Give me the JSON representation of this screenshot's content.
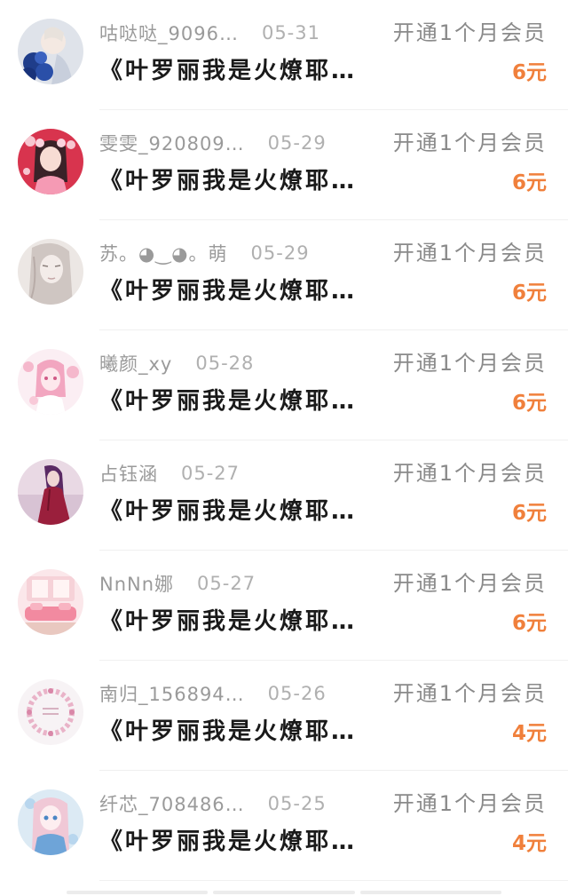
{
  "records": [
    {
      "nickname": "咕哒哒_9096…",
      "date": "05-31",
      "action": "开通1个月会员",
      "book": "《叶罗丽我是火燎耶…",
      "price": "6元",
      "avatar_icon": "avatar-blue-flowers"
    },
    {
      "nickname": "雯雯_920809…",
      "date": "05-29",
      "action": "开通1个月会员",
      "book": "《叶罗丽我是火燎耶…",
      "price": "6元",
      "avatar_icon": "avatar-pink-girl"
    },
    {
      "nickname": "苏。◕‿◕。萌",
      "date": "05-29",
      "action": "开通1个月会员",
      "book": "《叶罗丽我是火燎耶…",
      "price": "6元",
      "avatar_icon": "avatar-sketch-girl"
    },
    {
      "nickname": "曦颜_xy",
      "date": "05-28",
      "action": "开通1个月会员",
      "book": "《叶罗丽我是火燎耶…",
      "price": "6元",
      "avatar_icon": "avatar-pink-anime"
    },
    {
      "nickname": "占钰涵",
      "date": "05-27",
      "action": "开通1个月会员",
      "book": "《叶罗丽我是火燎耶…",
      "price": "6元",
      "avatar_icon": "avatar-purple-dress"
    },
    {
      "nickname": "NnNn娜",
      "date": "05-27",
      "action": "开通1个月会员",
      "book": "《叶罗丽我是火燎耶…",
      "price": "6元",
      "avatar_icon": "avatar-pink-room"
    },
    {
      "nickname": "南归_156894…",
      "date": "05-26",
      "action": "开通1个月会员",
      "book": "《叶罗丽我是火燎耶…",
      "price": "4元",
      "avatar_icon": "avatar-floral-wreath"
    },
    {
      "nickname": "纤芯_708486…",
      "date": "05-25",
      "action": "开通1个月会员",
      "book": "《叶罗丽我是火燎耶…",
      "price": "4元",
      "avatar_icon": "avatar-blue-anime"
    }
  ],
  "colors": {
    "price": "#f0803c",
    "meta": "#9a9a9a",
    "title": "#1a1a1a"
  }
}
